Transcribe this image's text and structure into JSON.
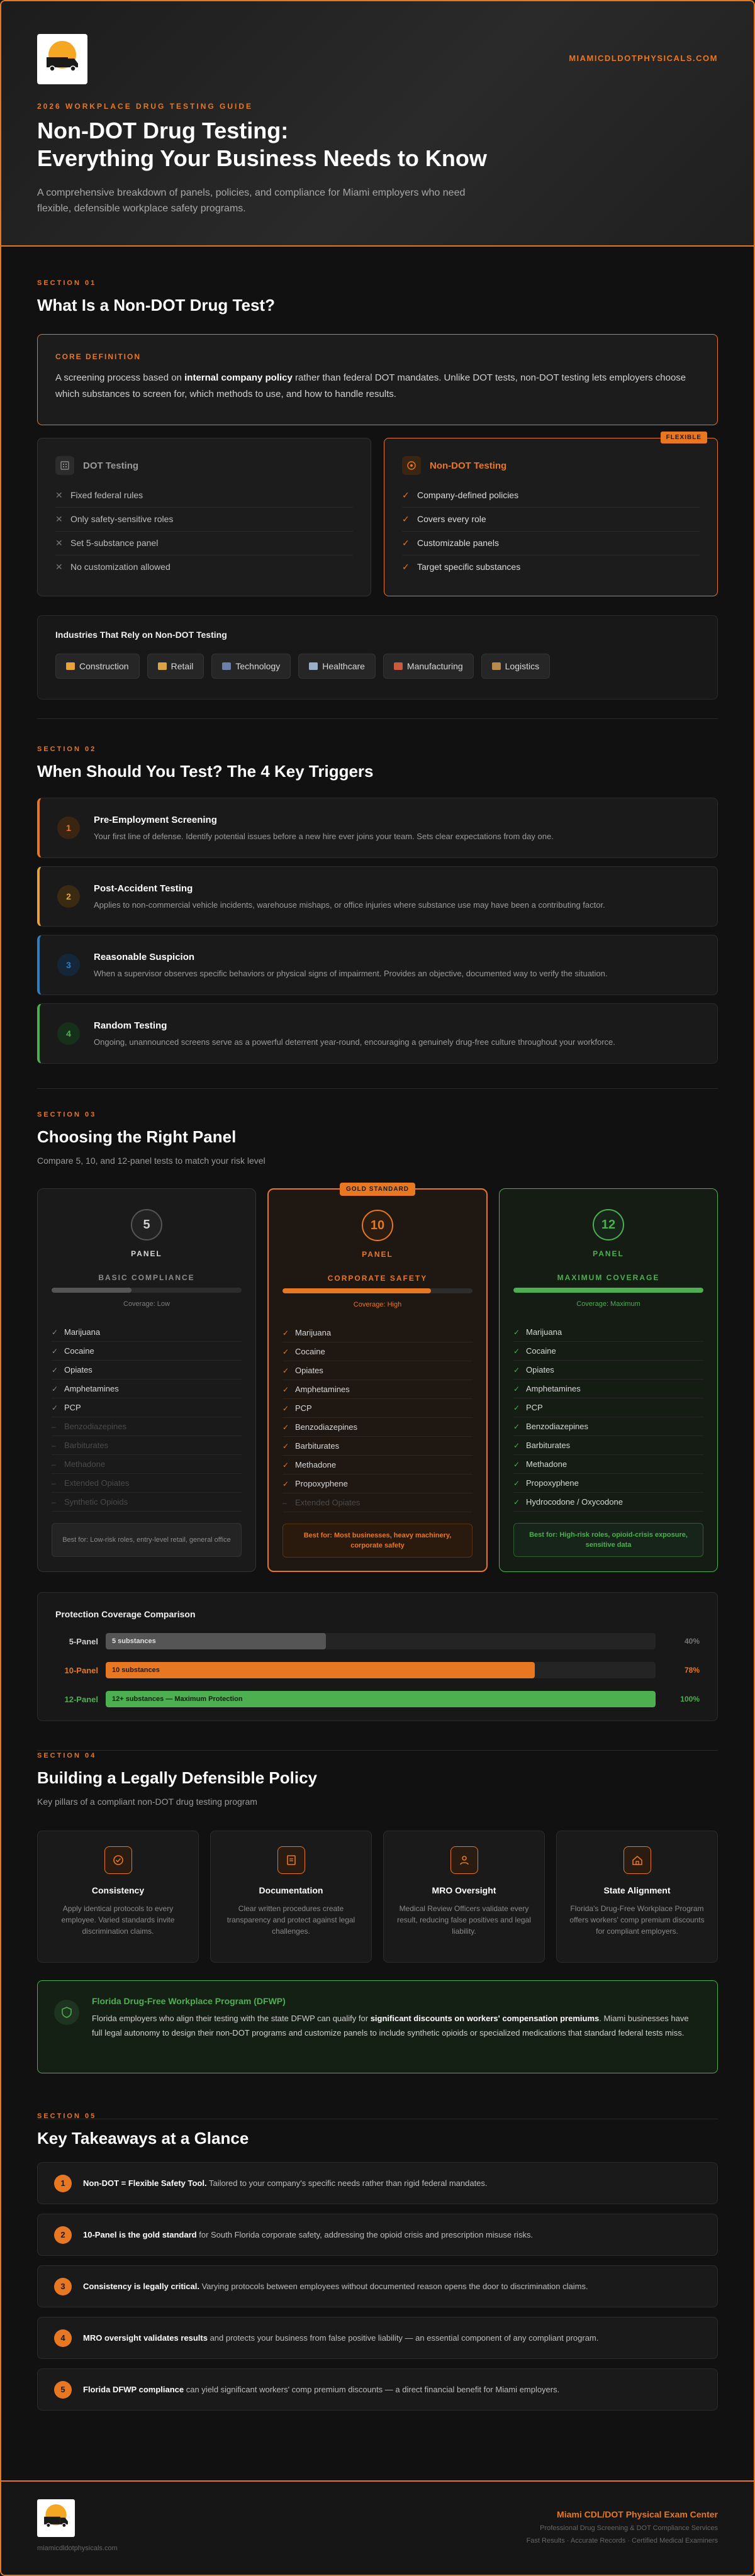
{
  "hero": {
    "site": "MIAMICDLDOTPHYSICALS.COM",
    "eyebrow": "2026 WORKPLACE DRUG TESTING GUIDE",
    "title_line1": "Non-DOT Drug Testing:",
    "title_line2": "Everything Your Business Needs to Know",
    "subtitle": "A comprehensive breakdown of panels, policies, and compliance for Miami employers who need flexible, defensible workplace safety programs."
  },
  "s1": {
    "label": "SECTION 01",
    "title": "What Is a Non-DOT Drug Test?",
    "core_label": "CORE DEFINITION",
    "core_pre": "A screening process based on ",
    "core_bold": "internal company policy",
    "core_post": " rather than federal DOT mandates. Unlike DOT tests, non-DOT testing lets employers choose which substances to screen for, which methods to use, and how to handle results.",
    "dot": {
      "title": "DOT Testing",
      "items": [
        "Fixed federal rules",
        "Only safety-sensitive roles",
        "Set 5-substance panel",
        "No customization allowed"
      ]
    },
    "nondot": {
      "title": "Non-DOT Testing",
      "badge": "FLEXIBLE",
      "items": [
        "Company-defined policies",
        "Covers every role",
        "Customizable panels",
        "Target specific substances"
      ]
    },
    "industries_title": "Industries That Rely on Non-DOT Testing",
    "industries": [
      {
        "label": "Construction",
        "color": "#e8a23a"
      },
      {
        "label": "Retail",
        "color": "#d9a441"
      },
      {
        "label": "Technology",
        "color": "#6b7fa8"
      },
      {
        "label": "Healthcare",
        "color": "#9ab0c8"
      },
      {
        "label": "Manufacturing",
        "color": "#c95b3e"
      },
      {
        "label": "Logistics",
        "color": "#b98a4e"
      }
    ]
  },
  "s2": {
    "label": "SECTION 02",
    "title": "When Should You Test? The 4 Key Triggers",
    "triggers": [
      {
        "num": "1",
        "title": "Pre-Employment Screening",
        "desc": "Your first line of defense. Identify potential issues before a new hire ever joins your team. Sets clear expectations from day one.",
        "color": "#e87722",
        "bg": "#3a2412"
      },
      {
        "num": "2",
        "title": "Post-Accident Testing",
        "desc": "Applies to non-commercial vehicle incidents, warehouse mishaps, or office injuries where substance use may have been a contributing factor.",
        "color": "#e8a23a",
        "bg": "#3a2a12"
      },
      {
        "num": "3",
        "title": "Reasonable Suspicion",
        "desc": "When a supervisor observes specific behaviors or physical signs of impairment. Provides an objective, documented way to verify the situation.",
        "color": "#2f7fc1",
        "bg": "#142638"
      },
      {
        "num": "4",
        "title": "Random Testing",
        "desc": "Ongoing, unannounced screens serve as a powerful deterrent year-round, encouraging a genuinely drug-free culture throughout your workforce.",
        "color": "#4caf50",
        "bg": "#17301a"
      }
    ]
  },
  "s3": {
    "label": "SECTION 03",
    "title": "Choosing the Right Panel",
    "subtitle": "Compare 5, 10, and 12-panel tests to match your risk level",
    "panels": [
      {
        "num": "5",
        "label": "PANEL",
        "tier": "BASIC COMPLIANCE",
        "coverage": "Coverage: Low",
        "fill": 0.42,
        "fill_color": "#555555",
        "items": [
          {
            "t": "Marijuana",
            "on": true
          },
          {
            "t": "Cocaine",
            "on": true
          },
          {
            "t": "Opiates",
            "on": true
          },
          {
            "t": "Amphetamines",
            "on": true
          },
          {
            "t": "PCP",
            "on": true
          },
          {
            "t": "Benzodiazepines",
            "on": false
          },
          {
            "t": "Barbiturates",
            "on": false
          },
          {
            "t": "Methadone",
            "on": false
          },
          {
            "t": "Extended Opiates",
            "on": false
          },
          {
            "t": "Synthetic Opioids",
            "on": false
          }
        ],
        "best": "Best for: Low-risk roles, entry-level retail, general office"
      },
      {
        "num": "10",
        "label": "PANEL",
        "tier": "CORPORATE SAFETY",
        "coverage": "Coverage: High",
        "fill": 0.78,
        "fill_color": "#e87722",
        "badge": "GOLD STANDARD",
        "items": [
          {
            "t": "Marijuana",
            "on": true
          },
          {
            "t": "Cocaine",
            "on": true
          },
          {
            "t": "Opiates",
            "on": true
          },
          {
            "t": "Amphetamines",
            "on": true
          },
          {
            "t": "PCP",
            "on": true
          },
          {
            "t": "Benzodiazepines",
            "on": true
          },
          {
            "t": "Barbiturates",
            "on": true
          },
          {
            "t": "Methadone",
            "on": true
          },
          {
            "t": "Propoxyphene",
            "on": true
          },
          {
            "t": "Extended Opiates",
            "on": false
          }
        ],
        "best": "Best for: Most businesses, heavy machinery, corporate safety"
      },
      {
        "num": "12",
        "label": "PANEL",
        "tier": "MAXIMUM COVERAGE",
        "coverage": "Coverage: Maximum",
        "fill": 1.0,
        "fill_color": "#4caf50",
        "items": [
          {
            "t": "Marijuana",
            "on": true
          },
          {
            "t": "Cocaine",
            "on": true
          },
          {
            "t": "Opiates",
            "on": true
          },
          {
            "t": "Amphetamines",
            "on": true
          },
          {
            "t": "PCP",
            "on": true
          },
          {
            "t": "Benzodiazepines",
            "on": true
          },
          {
            "t": "Barbiturates",
            "on": true
          },
          {
            "t": "Methadone",
            "on": true
          },
          {
            "t": "Propoxyphene",
            "on": true
          },
          {
            "t": "Hydrocodone / Oxycodone",
            "on": true
          }
        ],
        "best": "Best for: High-risk roles, opioid-crisis exposure, sensitive data"
      }
    ],
    "coverage_title": "Protection Coverage Comparison",
    "coverage_rows": [
      {
        "name": "5-Panel",
        "bar_label": "5 substances",
        "pct": "40%",
        "value": 0.4,
        "color": "#555555",
        "text_color": "#e0e0e0",
        "name_color": "#cfcfcf",
        "pct_color": "#777777"
      },
      {
        "name": "10-Panel",
        "bar_label": "10 substances",
        "pct": "78%",
        "value": 0.78,
        "color": "#e87722",
        "text_color": "#1a1a1a",
        "name_color": "#e87722",
        "pct_color": "#e87722"
      },
      {
        "name": "12-Panel",
        "bar_label": "12+ substances — Maximum Protection",
        "pct": "100%",
        "value": 1.0,
        "color": "#4caf50",
        "text_color": "#0f1f10",
        "name_color": "#4caf50",
        "pct_color": "#4caf50"
      }
    ]
  },
  "s4": {
    "label": "SECTION 04",
    "title": "Building a Legally Defensible Policy",
    "subtitle": "Key pillars of a compliant non-DOT drug testing program",
    "pillars": [
      {
        "icon": "check-badge-icon",
        "title": "Consistency",
        "desc": "Apply identical protocols to every employee. Varied standards invite discrimination claims."
      },
      {
        "icon": "document-icon",
        "title": "Documentation",
        "desc": "Clear written procedures create transparency and protect against legal challenges."
      },
      {
        "icon": "doctor-icon",
        "title": "MRO Oversight",
        "desc": "Medical Review Officers validate every result, reducing false positives and legal liability."
      },
      {
        "icon": "home-icon",
        "title": "State Alignment",
        "desc": "Florida's Drug-Free Workplace Program offers workers' comp premium discounts for compliant employers."
      }
    ],
    "dfwp_title": "Florida Drug-Free Workplace Program (DFWP)",
    "dfwp_pre": "Florida employers who align their testing with the state DFWP can qualify for ",
    "dfwp_bold": "significant discounts on workers' compensation premiums",
    "dfwp_post": ". Miami businesses have full legal autonomy to design their non-DOT programs and customize panels to include synthetic opioids or specialized medications that standard federal tests miss."
  },
  "s5": {
    "label": "SECTION 05",
    "title": "Key Takeaways at a Glance",
    "items": [
      {
        "num": "1",
        "bold": "Non-DOT = Flexible Safety Tool.",
        "rest": " Tailored to your company's specific needs rather than rigid federal mandates."
      },
      {
        "num": "2",
        "bold": "10-Panel is the gold standard",
        "rest": " for South Florida corporate safety, addressing the opioid crisis and prescription misuse risks."
      },
      {
        "num": "3",
        "bold": "Consistency is legally critical.",
        "rest": " Varying protocols between employees without documented reason opens the door to discrimination claims."
      },
      {
        "num": "4",
        "bold": "MRO oversight validates results",
        "rest": " and protects your business from false positive liability — an essential component of any compliant program."
      },
      {
        "num": "5",
        "bold": "Florida DFWP compliance",
        "rest": " can yield significant workers' comp premium discounts — a direct financial benefit for Miami employers."
      }
    ]
  },
  "footer": {
    "site": "miamicdldotphysicals.com",
    "name": "Miami CDL/DOT Physical Exam Center",
    "line1": "Professional Drug Screening & DOT Compliance Services",
    "line2": "Fast Results · Accurate Records · Certified Medical Examiners"
  }
}
